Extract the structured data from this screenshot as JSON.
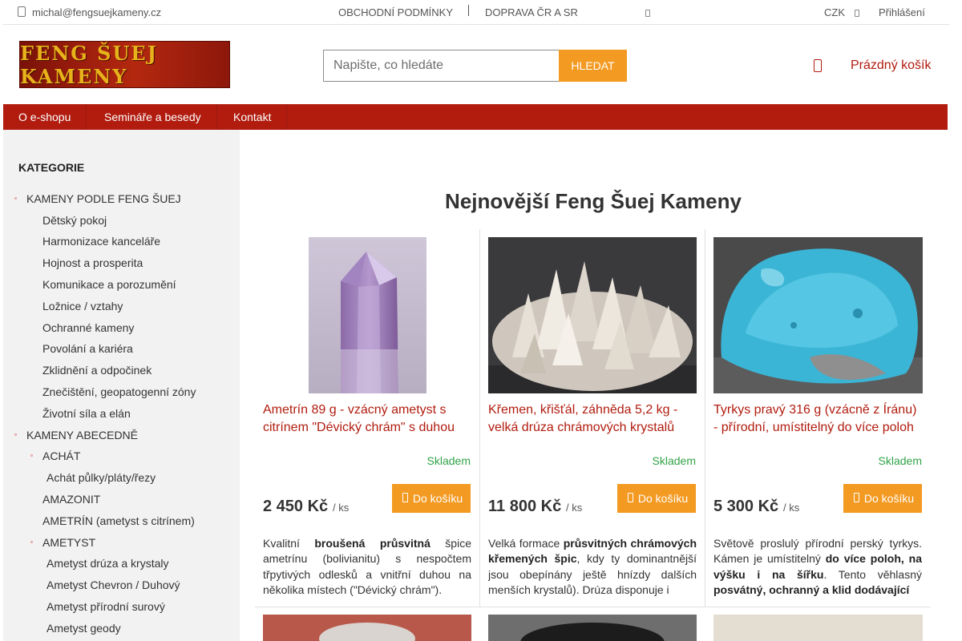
{
  "topbar": {
    "email": "michal@fengsuejkameny.cz",
    "links": [
      "Obchodní podmínky",
      "Doprava ČR a SR"
    ],
    "currency": "CZK",
    "login": "Přihlášení"
  },
  "header": {
    "logo_text": "FENG ŠUEJ KAMENY",
    "search_placeholder": "Napište, co hledáte",
    "search_button": "Hledat",
    "cart_label": "Prázdný košík"
  },
  "nav": [
    "O e-shopu",
    "Semináře a besedy",
    "Kontakt"
  ],
  "sidebar": {
    "title": "KATEGORIE",
    "groups": [
      {
        "label": "KAMENY PODLE FENG ŠUEJ",
        "items": [
          "Dětský pokoj",
          "Harmonizace kanceláře",
          "Hojnost a prosperita",
          "Komunikace a porozumění",
          "Ložnice / vztahy",
          "Ochranné kameny",
          "Povolání a kariéra",
          "Zklidnění a odpočinek",
          "Znečištění, geopatogenní zóny",
          "Životní síla a elán"
        ]
      },
      {
        "label": "KAMENY ABECEDNĚ",
        "items": [
          {
            "label": "ACHÁT",
            "sub": [
              "Achát půlky/pláty/řezy"
            ]
          },
          {
            "label": "AMAZONIT"
          },
          {
            "label": "AMETRÍN (ametyst s citrínem)"
          },
          {
            "label": "AMETYST",
            "sub": [
              "Ametyst drúza a krystaly",
              "Ametyst Chevron / Duhový",
              "Ametyst přírodní surový",
              "Ametyst geody"
            ]
          }
        ]
      }
    ]
  },
  "main": {
    "title": "Nejnovější Feng Šuej Kameny",
    "products": [
      {
        "name": "Ametrín 89 g - vzácný ametyst s citrínem \"Dévický chrám\" s duhou",
        "stock": "Skladem",
        "price": "2 450 Kč",
        "unit": "/ ks",
        "button": "Do košíku",
        "desc_html": "Kvalitní <b>broušená průsvitná</b> špice ametrínu (bolivianitu) s nespočtem třpytivých odlesků a vnitřní duhou na několika místech (\"Dévický chrám\").",
        "image": "purple-crystal"
      },
      {
        "name": "Křemen, křišťál, záhněda 5,2 kg - velká drúza chrámových krystalů",
        "stock": "Skladem",
        "price": "11 800 Kč",
        "unit": "/ ks",
        "button": "Do košíku",
        "desc_html": "Velká formace <b>průsvitných chrámových křemených špic</b>, kdy ty dominantnější jsou obepínány ještě hnízdy dalších menších krystalů). Drúza disponuje i",
        "image": "quartz-cluster"
      },
      {
        "name": "Tyrkys pravý 316 g (vzácně z Íránu) - přírodní, umístitelný do více poloh",
        "stock": "Skladem",
        "price": "5 300 Kč",
        "unit": "/ ks",
        "button": "Do košíku",
        "desc_html": "Světově proslulý přírodní perský tyrkys. Kámen je umístitelný <b>do více poloh, na výšku i na šířku</b>. Tento věhlasný <b>posvátný, ochranný a klid dodávající</b>",
        "image": "turquoise"
      }
    ]
  }
}
